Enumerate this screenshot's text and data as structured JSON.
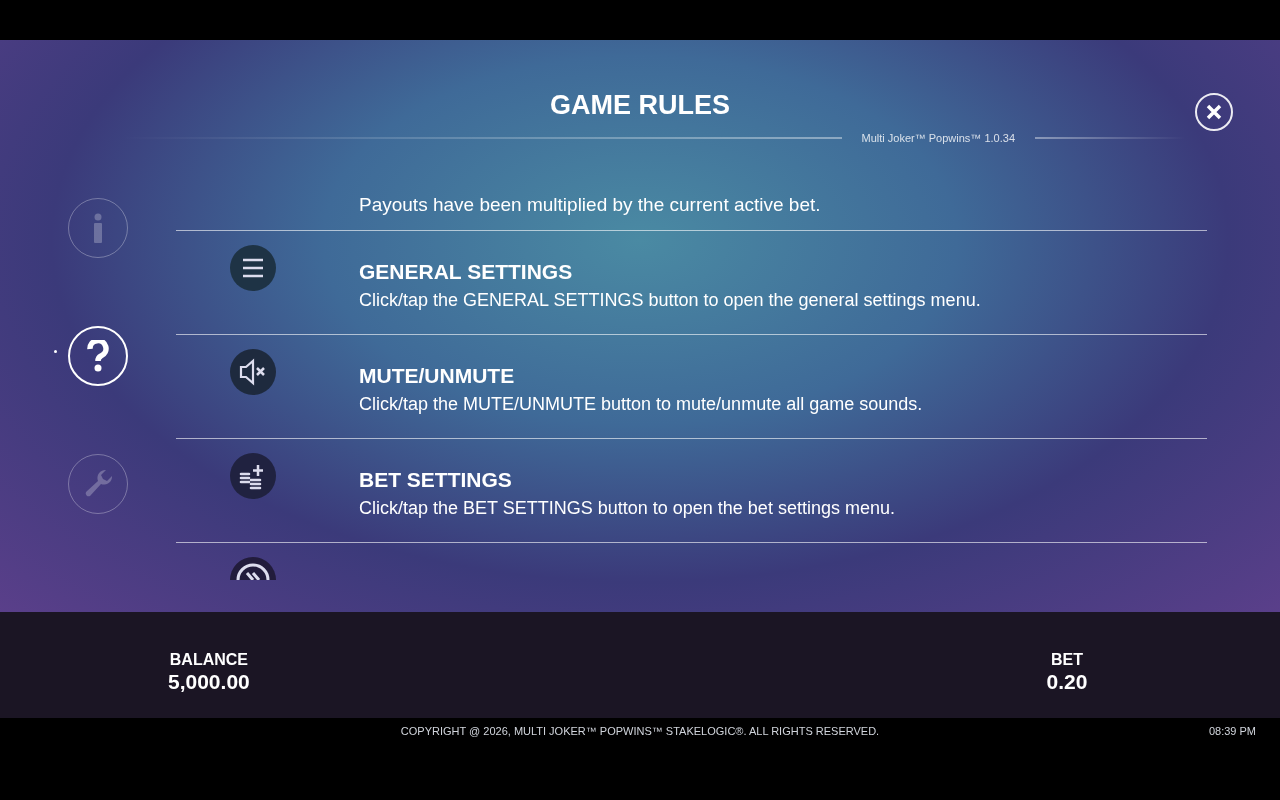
{
  "title": "GAME RULES",
  "version": "Multi Joker™ Popwins™ 1.0.34",
  "side_tabs": [
    {
      "kind": "info",
      "selected": false
    },
    {
      "kind": "help",
      "selected": true
    },
    {
      "kind": "settings",
      "selected": false
    }
  ],
  "intro": "Payouts have been multiplied by the current active bet.",
  "rules": [
    {
      "kind": "menu",
      "heading": "GENERAL SETTINGS",
      "text": "Click/tap the GENERAL SETTINGS button to open the general settings menu."
    },
    {
      "kind": "mute",
      "heading": "MUTE/UNMUTE",
      "text": "Click/tap the MUTE/UNMUTE button to mute/unmute all game sounds."
    },
    {
      "kind": "bet",
      "heading": "BET SETTINGS",
      "text": "Click/tap the BET SETTINGS button to open the bet settings menu."
    },
    {
      "kind": "turbo"
    }
  ],
  "balance": {
    "label": "BALANCE",
    "value": "5,000.00"
  },
  "bet": {
    "label": "BET",
    "value": "0.20"
  },
  "copyright": "COPYRIGHT @ 2026, MULTI JOKER™ POPWINS™ STAKELOGIC®. ALL RIGHTS RESERVED.",
  "time": "08:39 PM"
}
